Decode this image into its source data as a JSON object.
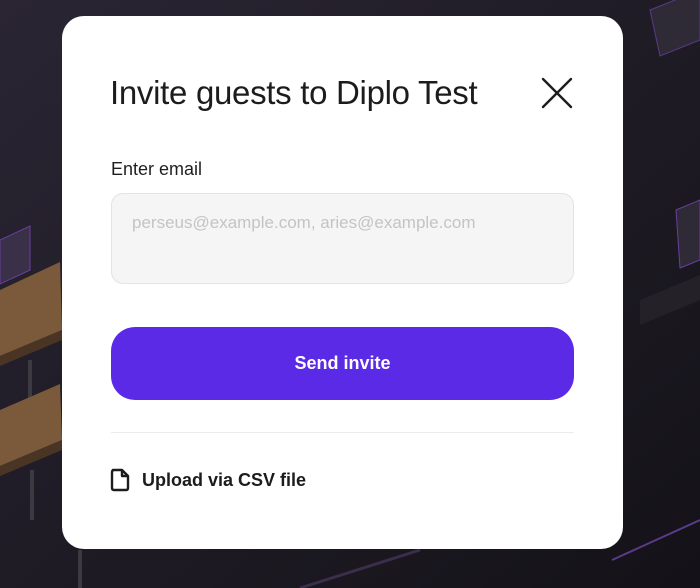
{
  "modal": {
    "title": "Invite guests to Diplo Test",
    "close_icon": "close-icon",
    "email": {
      "label": "Enter email",
      "value": "",
      "placeholder": "perseus@example.com, aries@example.com"
    },
    "send_button_label": "Send invite",
    "upload": {
      "icon": "file-icon",
      "label": "Upload via CSV file"
    }
  },
  "colors": {
    "accent": "#5a2ae6",
    "backdrop": "#1e1b25",
    "modal_bg": "#ffffff",
    "input_bg": "#f5f5f5"
  }
}
